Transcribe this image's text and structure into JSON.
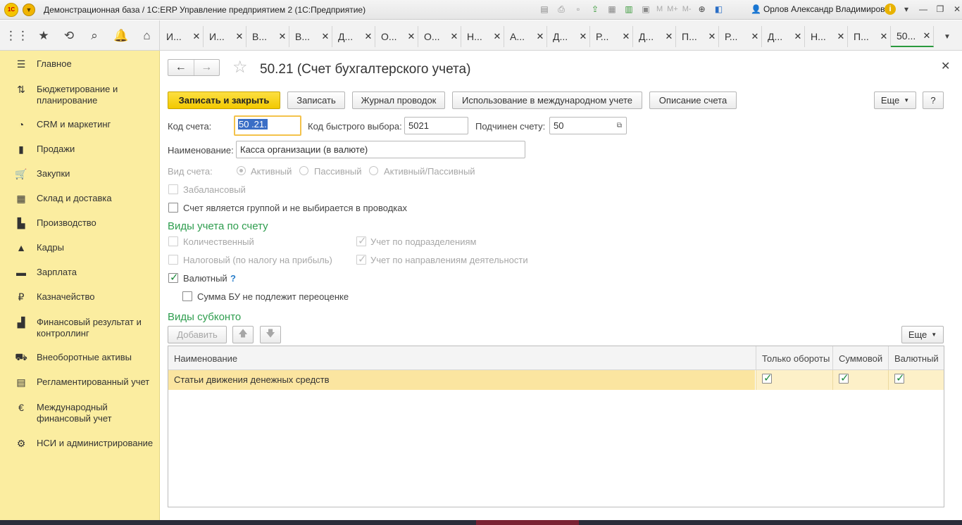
{
  "titlebar": {
    "title": "Демонстрационная база / 1С:ERP Управление предприятием 2  (1С:Предприятие)",
    "logo_text": "1С",
    "tools_text": [
      "M",
      "M+",
      "M-"
    ],
    "user": "Орлов Александр Владимирович"
  },
  "tabs": [
    "И...",
    "И...",
    "В...",
    "В...",
    "Д...",
    "О...",
    "О...",
    "Н...",
    "А...",
    "Д...",
    "Р...",
    "Д...",
    "П...",
    "Р...",
    "Д...",
    "Н...",
    "П...",
    "50..."
  ],
  "sidebar": {
    "items": [
      {
        "label": "Главное",
        "icon": "menu-lines-icon"
      },
      {
        "label": "Бюджетирование и планирование",
        "icon": "budget-icon"
      },
      {
        "label": "CRM и маркетинг",
        "icon": "crm-pie-icon"
      },
      {
        "label": "Продажи",
        "icon": "sales-bag-icon"
      },
      {
        "label": "Закупки",
        "icon": "purchases-cart-icon"
      },
      {
        "label": "Склад и доставка",
        "icon": "warehouse-grid-icon"
      },
      {
        "label": "Производство",
        "icon": "factory-icon"
      },
      {
        "label": "Кадры",
        "icon": "staff-person-icon"
      },
      {
        "label": "Зарплата",
        "icon": "salary-wallet-icon"
      },
      {
        "label": "Казначейство",
        "icon": "treasury-ruble-icon"
      },
      {
        "label": "Финансовый результат и контроллинг",
        "icon": "finance-chart-icon"
      },
      {
        "label": "Внеоборотные активы",
        "icon": "fixed-assets-truck-icon"
      },
      {
        "label": "Регламентированный учет",
        "icon": "regulated-doc-icon"
      },
      {
        "label": "Международный финансовый учет",
        "icon": "international-euro-icon"
      },
      {
        "label": "НСИ и администрирование",
        "icon": "gear-icon"
      }
    ]
  },
  "form": {
    "title": "50.21 (Счет бухгалтерского учета)",
    "buttons": {
      "save_close": "Записать и закрыть",
      "save": "Записать",
      "journal": "Журнал проводок",
      "intl": "Использование в международном учете",
      "description": "Описание счета",
      "more": "Еще",
      "help": "?"
    },
    "fields": {
      "code_label": "Код счета:",
      "code_value": "50 .21.",
      "quick_label": "Код быстрого выбора:",
      "quick_value": "5021",
      "parent_label": "Подчинен счету:",
      "parent_value": "50",
      "name_label": "Наименование:",
      "name_value": "Касса организации (в валюте)"
    },
    "account_type": {
      "label": "Вид счета:",
      "options": [
        "Активный",
        "Пассивный",
        "Активный/Пассивный"
      ],
      "selected": "Активный"
    },
    "offbalance": {
      "label": "Забалансовый",
      "checked": false
    },
    "is_group": {
      "label": "Счет является группой и не выбирается в проводках",
      "checked": false
    },
    "accounting_section": {
      "title": "Виды учета по счету",
      "quantity": {
        "label": "Количественный",
        "checked": false
      },
      "tax": {
        "label": "Налоговый (по налогу на прибыль)",
        "checked": false
      },
      "by_division": {
        "label": "Учет по подразделениям",
        "checked": true
      },
      "by_activity": {
        "label": "Учет по направлениям деятельности",
        "checked": true
      },
      "currency": {
        "label": "Валютный",
        "checked": true,
        "help": "?"
      },
      "no_revaluation": {
        "label": "Сумма БУ не подлежит переоценке",
        "checked": false
      }
    },
    "subconto": {
      "title": "Виды субконто",
      "add_label": "Добавить",
      "more_label": "Еще",
      "columns": [
        "Наименование",
        "Только обороты",
        "Суммовой",
        "Валютный"
      ],
      "rows": [
        {
          "name": "Статьи движения денежных средств",
          "turnover_only": true,
          "sum": true,
          "currency": true
        }
      ]
    }
  },
  "colors": {
    "sidebar_bg": "#fbeda0",
    "primary_button": "#f5d000",
    "section_title": "#2e9d4e",
    "selected_row": "#fbe5a0",
    "check_green": "#1e8a3c"
  }
}
